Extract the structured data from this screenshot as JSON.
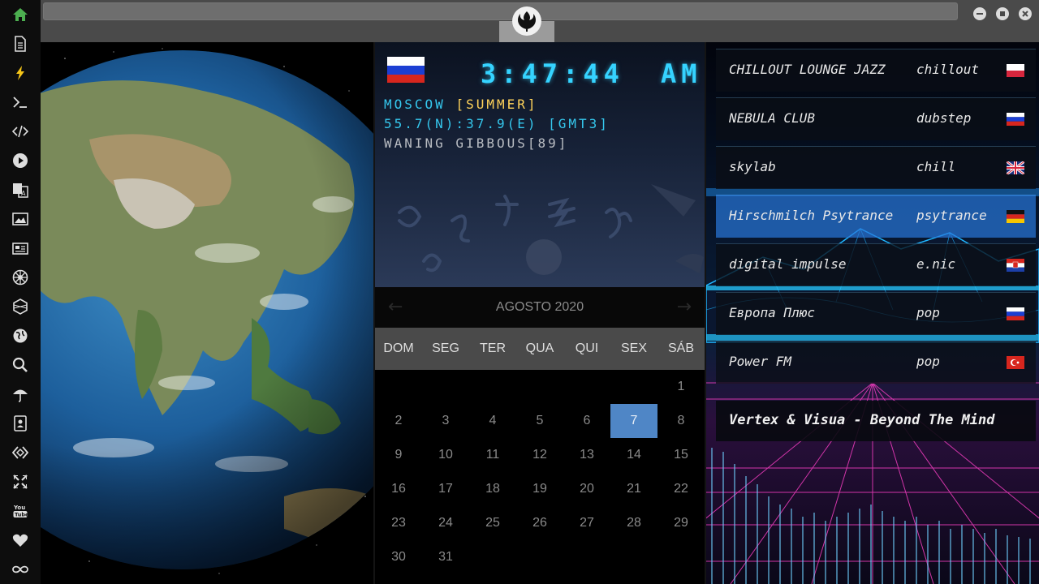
{
  "sidebar": {
    "items": [
      {
        "icon": "home-icon",
        "active": true
      },
      {
        "icon": "document-icon"
      },
      {
        "icon": "lightning-icon"
      },
      {
        "icon": "terminal-icon"
      },
      {
        "icon": "code-icon"
      },
      {
        "icon": "play-icon"
      },
      {
        "icon": "translate-icon"
      },
      {
        "icon": "image-icon"
      },
      {
        "icon": "newspaper-icon"
      },
      {
        "icon": "empire-icon"
      },
      {
        "icon": "hexagon-icon"
      },
      {
        "icon": "globe-icon"
      },
      {
        "icon": "search-icon"
      },
      {
        "icon": "umbrella-icon"
      },
      {
        "icon": "contacts-icon"
      },
      {
        "icon": "diamond-code-icon"
      },
      {
        "icon": "expand-icon"
      },
      {
        "icon": "youtube-icon"
      },
      {
        "icon": "heart-icon"
      },
      {
        "icon": "infinity-cloud-icon"
      }
    ],
    "active_color": "#4caf50"
  },
  "titlebar": {
    "logo": "rebel-alliance-icon"
  },
  "clock": {
    "time": "3:47:44",
    "ampm": "AM",
    "city": "MOSCOW",
    "season": "[SUMMER]",
    "coords": "55.7(N):37.9(E) [GMT3]",
    "moon": "WANING GIBBOUS[89]",
    "flag": "russia-flag"
  },
  "calendar": {
    "month_label": "AGOSTO 2020",
    "prev": "←",
    "next": "→",
    "weekdays": [
      "DOM",
      "SEG",
      "TER",
      "QUA",
      "QUI",
      "SEX",
      "SÁB"
    ],
    "first_weekday": 6,
    "days_in_month": 31,
    "today": 7
  },
  "radio": {
    "stations": [
      {
        "name": "CHILLOUT LOUNGE JAZZ",
        "genre": "chillout",
        "flag": "poland-flag"
      },
      {
        "name": "NEBULA CLUB",
        "genre": "dubstep",
        "flag": "russia-flag"
      },
      {
        "name": "skylab",
        "genre": "chill",
        "flag": "uk-flag"
      },
      {
        "name": "Hirschmilch Psytrance",
        "genre": "psytrance",
        "flag": "germany-flag",
        "selected": true
      },
      {
        "name": "digital impulse",
        "genre": "e.nic",
        "flag": "croatia-flag"
      },
      {
        "name": "Европа Плюс",
        "genre": "pop",
        "flag": "russia-flag"
      },
      {
        "name": "Power FM",
        "genre": "pop",
        "flag": "turkey-flag"
      }
    ],
    "now_playing": "Vertex & Visua - Beyond The Mind"
  }
}
